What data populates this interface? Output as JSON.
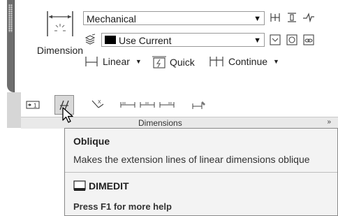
{
  "panel": {
    "big_button_label": "Dimension",
    "dim_style_value": "Mechanical",
    "layer_value": "Use Current",
    "linear_label": "Linear",
    "quick_label": "Quick",
    "continue_label": "Continue",
    "footer_label": "Dimensions"
  },
  "tooltip": {
    "title": "Oblique",
    "description": "Makes the extension lines of linear dimensions oblique",
    "command": "DIMEDIT",
    "help": "Press F1 for more help"
  },
  "colors": {
    "panel_border": "#6e6e6e",
    "tooltip_bg": "#f3f3f3",
    "active_button_bg": "#d9d9d9"
  }
}
